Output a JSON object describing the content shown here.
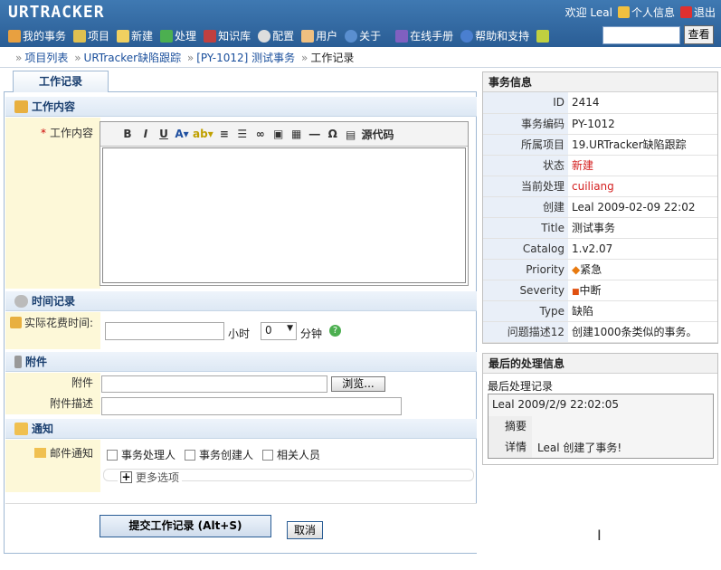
{
  "header": {
    "logo": "URTRACKER",
    "welcome": "欢迎 Leal",
    "profile": "个人信息",
    "logout": "退出",
    "search_button": "查看",
    "search_value": ""
  },
  "nav": [
    {
      "label": "我的事务",
      "icon": "home-icon"
    },
    {
      "label": "项目",
      "icon": "database-icon"
    },
    {
      "label": "新建",
      "icon": "new-icon"
    },
    {
      "label": "处理",
      "icon": "check-icon"
    },
    {
      "label": "知识库",
      "icon": "books-icon"
    },
    {
      "label": "配置",
      "icon": "gear-icon"
    },
    {
      "label": "用户",
      "icon": "users-icon"
    },
    {
      "label": "关于",
      "icon": "info-icon"
    },
    {
      "label": "在线手册",
      "icon": "manual-icon"
    },
    {
      "label": "帮助和支持",
      "icon": "help-icon"
    },
    {
      "label": "",
      "icon": "star-icon"
    }
  ],
  "breadcrumb": [
    "项目列表",
    "URTracker缺陷跟踪",
    "[PY-1012] 测试事务",
    "工作记录"
  ],
  "form": {
    "tab": "工作记录",
    "section_content": "工作内容",
    "content_label": "工作内容",
    "source_code": "源代码",
    "section_time": "时间记录",
    "time_label": "实际花费时间:",
    "hours_unit": "小时",
    "minutes_value": "0",
    "minutes_unit": "分钟",
    "section_attach": "附件",
    "attach_label": "附件",
    "browse_button": "浏览...",
    "attach_desc_label": "附件描述",
    "section_notify": "通知",
    "email_label": "邮件通知",
    "notify_options": [
      "事务处理人",
      "事务创建人",
      "相关人员"
    ],
    "more_options": "更多选项",
    "submit_button": "提交工作记录 (Alt+S)",
    "cancel_button": "取消"
  },
  "issue": {
    "title": "事务信息",
    "rows": [
      {
        "k": "ID",
        "v": "2414"
      },
      {
        "k": "事务编码",
        "v": "PY-1012"
      },
      {
        "k": "所属项目",
        "v": "19.URTracker缺陷跟踪"
      },
      {
        "k": "状态",
        "v": "新建"
      },
      {
        "k": "当前处理",
        "v": "cuiliang"
      },
      {
        "k": "创建",
        "v": "Leal  2009-02-09 22:02"
      },
      {
        "k": "Title",
        "v": "测试事务"
      },
      {
        "k": "Catalog",
        "v": "1.v2.07"
      },
      {
        "k": "Priority",
        "v": "紧急"
      },
      {
        "k": "Severity",
        "v": "中断"
      },
      {
        "k": "Type",
        "v": "缺陷"
      },
      {
        "k": "问题描述12",
        "v": "创建1000条类似的事务。"
      }
    ],
    "status_color": "#d42020",
    "priority_color": "#e87a10",
    "severity_color": "#e05010"
  },
  "last": {
    "title": "最后的处理信息",
    "subtitle": "最后处理记录",
    "entry": "Leal  2009/2/9 22:02:05",
    "summary_label": "摘要",
    "summary": "",
    "detail_label": "详情",
    "detail": "Leal 创建了事务!"
  }
}
